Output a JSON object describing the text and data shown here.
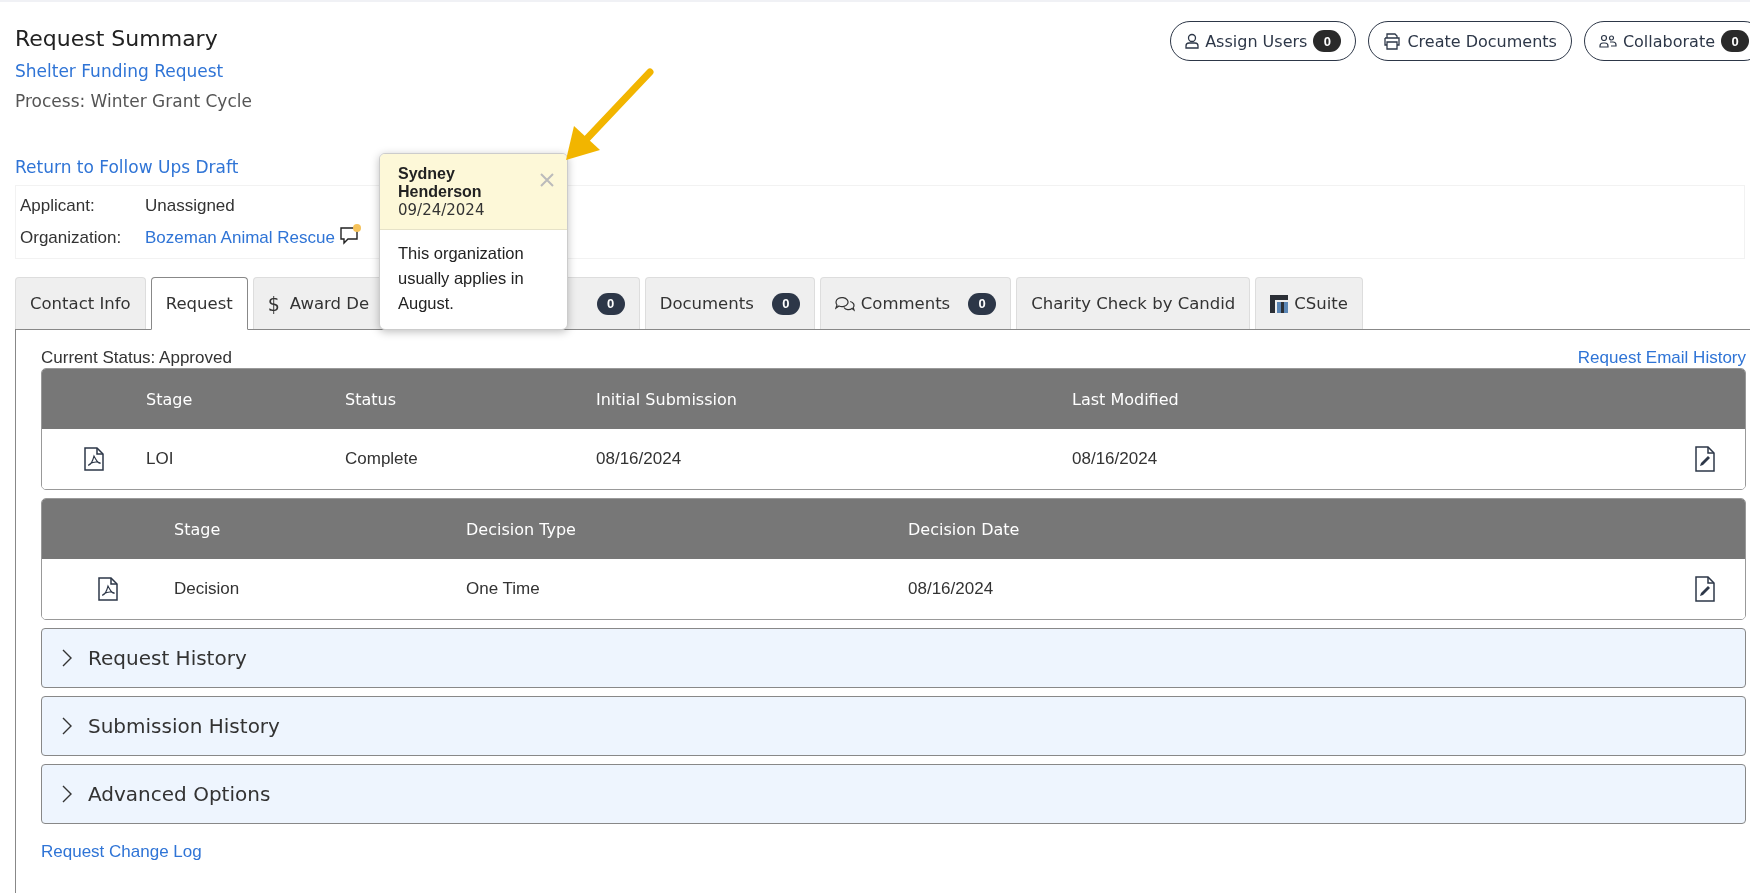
{
  "header": {
    "title": "Request Summary",
    "request_link": "Shelter Funding Request",
    "process": "Process: Winter Grant Cycle"
  },
  "header_buttons": [
    {
      "kind": "user",
      "label": "Assign Users",
      "count": "0"
    },
    {
      "kind": "printer",
      "label": "Create Documents"
    },
    {
      "kind": "users",
      "label": "Collaborate",
      "count": "0"
    }
  ],
  "return_link": "Return to Follow Ups Draft",
  "details": [
    {
      "label": "Applicant:",
      "value": "Unassigned",
      "kind": "text"
    },
    {
      "label": "Organization:",
      "value": "Bozeman Animal Rescue",
      "kind": "link",
      "comment_unread": true
    }
  ],
  "popover": {
    "author": "Sydney Henderson",
    "date": "09/24/2024",
    "text": "This organization usually applies in August."
  },
  "tabs": [
    {
      "label": "Contact Info",
      "selected": false
    },
    {
      "label": "Request",
      "selected": true
    },
    {
      "symbol": "$",
      "label": "Award De",
      "selected": false
    },
    {
      "count": "0",
      "selected": false
    },
    {
      "label": "Documents",
      "count": "0",
      "selected": false
    },
    {
      "kind": "comments",
      "label": "Comments",
      "count": "0",
      "selected": false
    },
    {
      "label": "Charity Check by Candid",
      "selected": false
    },
    {
      "kind": "csuite",
      "label": "CSuite",
      "selected": false
    }
  ],
  "current_status": "Current Status: Approved",
  "email_history_link": "Request Email History",
  "tables": [
    {
      "columns": [
        "Stage",
        "Status",
        "Initial Submission",
        "Last Modified"
      ],
      "rows": [
        {
          "cells": [
            "LOI",
            "Complete",
            "08/16/2024",
            "08/16/2024"
          ]
        }
      ]
    },
    {
      "columns": [
        "Stage",
        "Decision Type",
        "Decision Date"
      ],
      "rows": [
        {
          "cells": [
            "Decision",
            "One Time",
            "08/16/2024"
          ]
        }
      ]
    }
  ],
  "accordions": [
    {
      "label": "Request History",
      "expanded": false
    },
    {
      "label": "Submission History",
      "expanded": false
    },
    {
      "label": "Advanced Options",
      "expanded": false
    }
  ],
  "change_log_link": "Request Change Log"
}
